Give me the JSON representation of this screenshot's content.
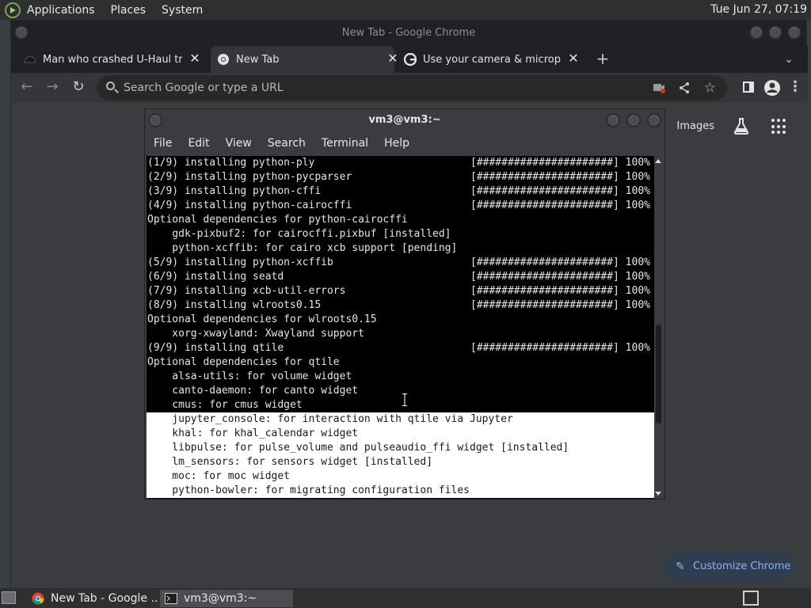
{
  "top_panel": {
    "menus": [
      "Applications",
      "Places",
      "System"
    ],
    "clock": "Tue Jun 27, 07:19"
  },
  "chrome": {
    "window_title": "New Tab - Google Chrome",
    "tabs": [
      {
        "title": "Man who crashed U-Haul truck",
        "active": false
      },
      {
        "title": "New Tab",
        "active": true
      },
      {
        "title": "Use your camera & microphone",
        "active": false
      }
    ],
    "new_tab_glyph": "+",
    "omnibox_placeholder": "Search Google or type a URL",
    "page": {
      "images_link": "Images",
      "customize_label": "Customize Chrome"
    }
  },
  "terminal": {
    "title": "vm3@vm3:~",
    "menu": [
      "File",
      "Edit",
      "View",
      "Search",
      "Terminal",
      "Help"
    ],
    "lines": [
      {
        "text": "(1/9) installing python-ply",
        "bar": "[######################] 100%"
      },
      {
        "text": "(2/9) installing python-pycparser",
        "bar": "[######################] 100%"
      },
      {
        "text": "(3/9) installing python-cffi",
        "bar": "[######################] 100%"
      },
      {
        "text": "(4/9) installing python-cairocffi",
        "bar": "[######################] 100%"
      },
      {
        "text": "Optional dependencies for python-cairocffi",
        "bar": ""
      },
      {
        "text": "    gdk-pixbuf2: for cairocffi.pixbuf [installed]",
        "bar": ""
      },
      {
        "text": "    python-xcffib: for cairo xcb support [pending]",
        "bar": ""
      },
      {
        "text": "(5/9) installing python-xcffib",
        "bar": "[######################] 100%"
      },
      {
        "text": "(6/9) installing seatd",
        "bar": "[######################] 100%"
      },
      {
        "text": "(7/9) installing xcb-util-errors",
        "bar": "[######################] 100%"
      },
      {
        "text": "(8/9) installing wlroots0.15",
        "bar": "[######################] 100%"
      },
      {
        "text": "Optional dependencies for wlroots0.15",
        "bar": ""
      },
      {
        "text": "    xorg-xwayland: Xwayland support",
        "bar": ""
      },
      {
        "text": "(9/9) installing qtile",
        "bar": "[######################] 100%"
      },
      {
        "text": "Optional dependencies for qtile",
        "bar": ""
      },
      {
        "text": "    alsa-utils: for volume widget",
        "bar": ""
      },
      {
        "text": "    canto-daemon: for canto widget",
        "bar": ""
      },
      {
        "text": "    cmus: for cmus widget",
        "bar": ""
      },
      {
        "text": "    jupyter_console: for interaction with qtile via Jupyter",
        "bar": "",
        "light": true
      },
      {
        "text": "    khal: for khal_calendar widget",
        "bar": "",
        "light": true
      },
      {
        "text": "    libpulse: for pulse_volume and pulseaudio_ffi widget [installed]",
        "bar": "",
        "light": true
      },
      {
        "text": "    lm_sensors: for sensors widget [installed]",
        "bar": "",
        "light": true
      },
      {
        "text": "    moc: for moc widget",
        "bar": "",
        "light": true
      },
      {
        "text": "    python-bowler: for migrating configuration files",
        "bar": "",
        "light": true
      }
    ]
  },
  "taskbar": {
    "tasks": [
      {
        "label": "New Tab - Google ...",
        "active": false
      },
      {
        "label": "vm3@vm3:~",
        "active": true
      }
    ]
  },
  "colors": {
    "accent_blue": "#8ab4f8",
    "terminal_bg": "#000000",
    "panel_bg": "#2d2f31"
  }
}
